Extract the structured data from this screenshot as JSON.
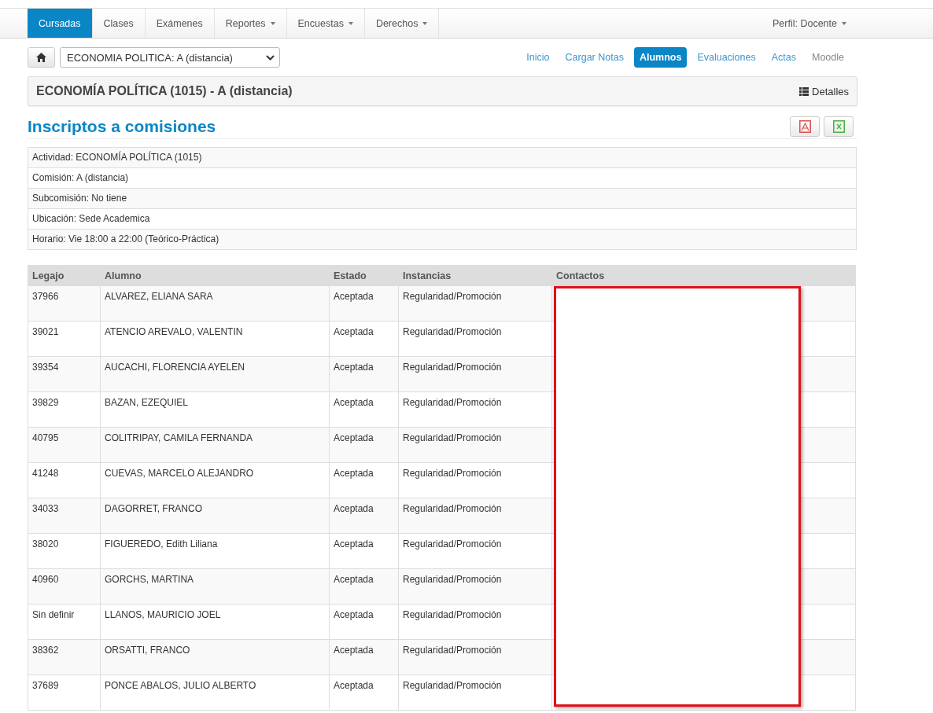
{
  "navbar": {
    "items": [
      {
        "label": "Cursadas",
        "selected": true,
        "dropdown": false
      },
      {
        "label": "Clases",
        "selected": false,
        "dropdown": false
      },
      {
        "label": "Exámenes",
        "selected": false,
        "dropdown": false
      },
      {
        "label": "Reportes",
        "selected": false,
        "dropdown": true
      },
      {
        "label": "Encuestas",
        "selected": false,
        "dropdown": true
      },
      {
        "label": "Derechos",
        "selected": false,
        "dropdown": true
      }
    ],
    "profile": {
      "label": "Perfil: Docente",
      "dropdown": true
    }
  },
  "course_select": {
    "value": "ECONOMIA POLITICA: A (distancia)"
  },
  "pills": [
    {
      "label": "Inicio",
      "selected": false,
      "disabled": false
    },
    {
      "label": "Cargar Notas",
      "selected": false,
      "disabled": false
    },
    {
      "label": "Alumnos",
      "selected": true,
      "disabled": false
    },
    {
      "label": "Evaluaciones",
      "selected": false,
      "disabled": false
    },
    {
      "label": "Actas",
      "selected": false,
      "disabled": false
    },
    {
      "label": "Moodle",
      "selected": false,
      "disabled": true
    }
  ],
  "panel": {
    "title": "ECONOMÍA POLÍTICA (1015) - A (distancia)",
    "details": "Detalles"
  },
  "section_title": "Inscriptos a comisiones",
  "info": [
    "Actividad: ECONOMÍA POLÍTICA (1015)",
    "Comisión: A (distancia)",
    "Subcomisión: No tiene",
    "Ubicación: Sede Academica",
    "Horario: Vie 18:00 a 22:00 (Teórico-Práctica)"
  ],
  "table": {
    "columns": [
      "Legajo",
      "Alumno",
      "Estado",
      "Instancias",
      "Contactos"
    ],
    "contacts_redacted": true,
    "rows": [
      [
        "37966",
        "ALVAREZ, ELIANA SARA",
        "Aceptada",
        "Regularidad/Promoción"
      ],
      [
        "39021",
        "ATENCIO AREVALO, VALENTIN",
        "Aceptada",
        "Regularidad/Promoción"
      ],
      [
        "39354",
        "AUCACHI, FLORENCIA AYELEN",
        "Aceptada",
        "Regularidad/Promoción"
      ],
      [
        "39829",
        "BAZAN, EZEQUIEL",
        "Aceptada",
        "Regularidad/Promoción"
      ],
      [
        "40795",
        "COLITRIPAY, CAMILA FERNANDA",
        "Aceptada",
        "Regularidad/Promoción"
      ],
      [
        "41248",
        "CUEVAS, MARCELO ALEJANDRO",
        "Aceptada",
        "Regularidad/Promoción"
      ],
      [
        "34033",
        "DAGORRET, FRANCO",
        "Aceptada",
        "Regularidad/Promoción"
      ],
      [
        "38020",
        "FIGUEREDO, Edith Liliana",
        "Aceptada",
        "Regularidad/Promoción"
      ],
      [
        "40960",
        "GORCHS, MARTINA",
        "Aceptada",
        "Regularidad/Promoción"
      ],
      [
        "Sin definir",
        "LLANOS, MAURICIO JOEL",
        "Aceptada",
        "Regularidad/Promoción"
      ],
      [
        "38362",
        "ORSATTI, FRANCO",
        "Aceptada",
        "Regularidad/Promoción"
      ],
      [
        "37689",
        "PONCE ABALOS, JULIO ALBERTO",
        "Aceptada",
        "Regularidad/Promoción"
      ]
    ]
  }
}
